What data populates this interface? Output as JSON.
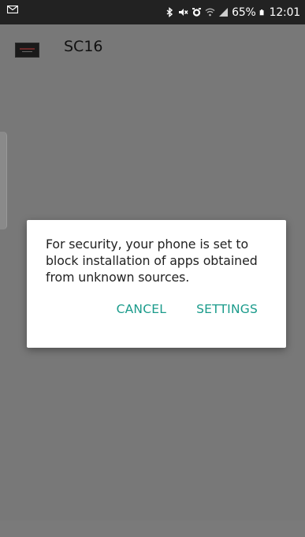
{
  "status_bar": {
    "battery": "65%",
    "time": "12:01"
  },
  "app_bar": {
    "title": "SC16"
  },
  "dialog": {
    "message": "For security, your phone is set to block installation of apps obtained from unknown sources.",
    "cancel_label": "CANCEL",
    "settings_label": "SETTINGS"
  },
  "colors": {
    "status_bar_bg": "#222222",
    "screen_dim": "#787878",
    "accent": "#1a9b8b"
  },
  "icons": [
    "mail-icon",
    "bluetooth-icon",
    "mute-icon",
    "alarm-icon",
    "wifi-icon",
    "signal-icon",
    "battery-icon"
  ]
}
